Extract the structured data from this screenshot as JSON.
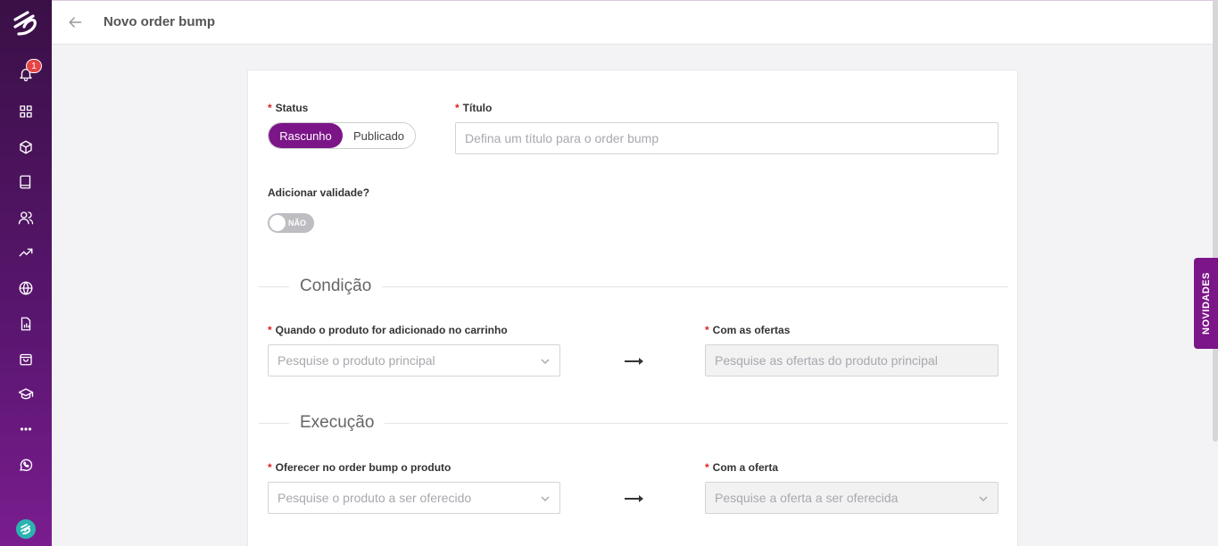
{
  "header": {
    "title": "Novo order bump"
  },
  "sidebar": {
    "notification_count": "1",
    "icons": [
      "bell-icon",
      "dashboard-icon",
      "box-icon",
      "book-icon",
      "users-icon",
      "trending-icon",
      "globe-icon",
      "report-icon",
      "bag-icon",
      "graduation-icon",
      "more-icon",
      "whatsapp-icon"
    ]
  },
  "form": {
    "status": {
      "label": "Status",
      "required_mark": "*",
      "options": [
        "Rascunho",
        "Publicado"
      ],
      "selected": "Rascunho"
    },
    "title": {
      "label": "Título",
      "required_mark": "*",
      "placeholder": "Defina um título para o order bump"
    },
    "validity": {
      "label": "Adicionar validade?",
      "toggle_text": "NÃO"
    },
    "condition": {
      "section_title": "Condição",
      "product": {
        "label": "Quando o produto for adicionado no carrinho",
        "required_mark": "*",
        "placeholder": "Pesquise o produto principal"
      },
      "offers": {
        "label": "Com as ofertas",
        "required_mark": "*",
        "placeholder": "Pesquise as ofertas do produto principal"
      }
    },
    "execution": {
      "section_title": "Execução",
      "product": {
        "label": "Oferecer no order bump o produto",
        "required_mark": "*",
        "placeholder": "Pesquise o produto a ser oferecido"
      },
      "offer": {
        "label": "Com a oferta",
        "required_mark": "*",
        "placeholder": "Pesquise a oferta a ser oferecida"
      }
    }
  },
  "novidades_tab": "NOVIDADES",
  "colors": {
    "brand": "#7b1588",
    "sidebar_top": "#3a1046",
    "required": "#e02020"
  }
}
